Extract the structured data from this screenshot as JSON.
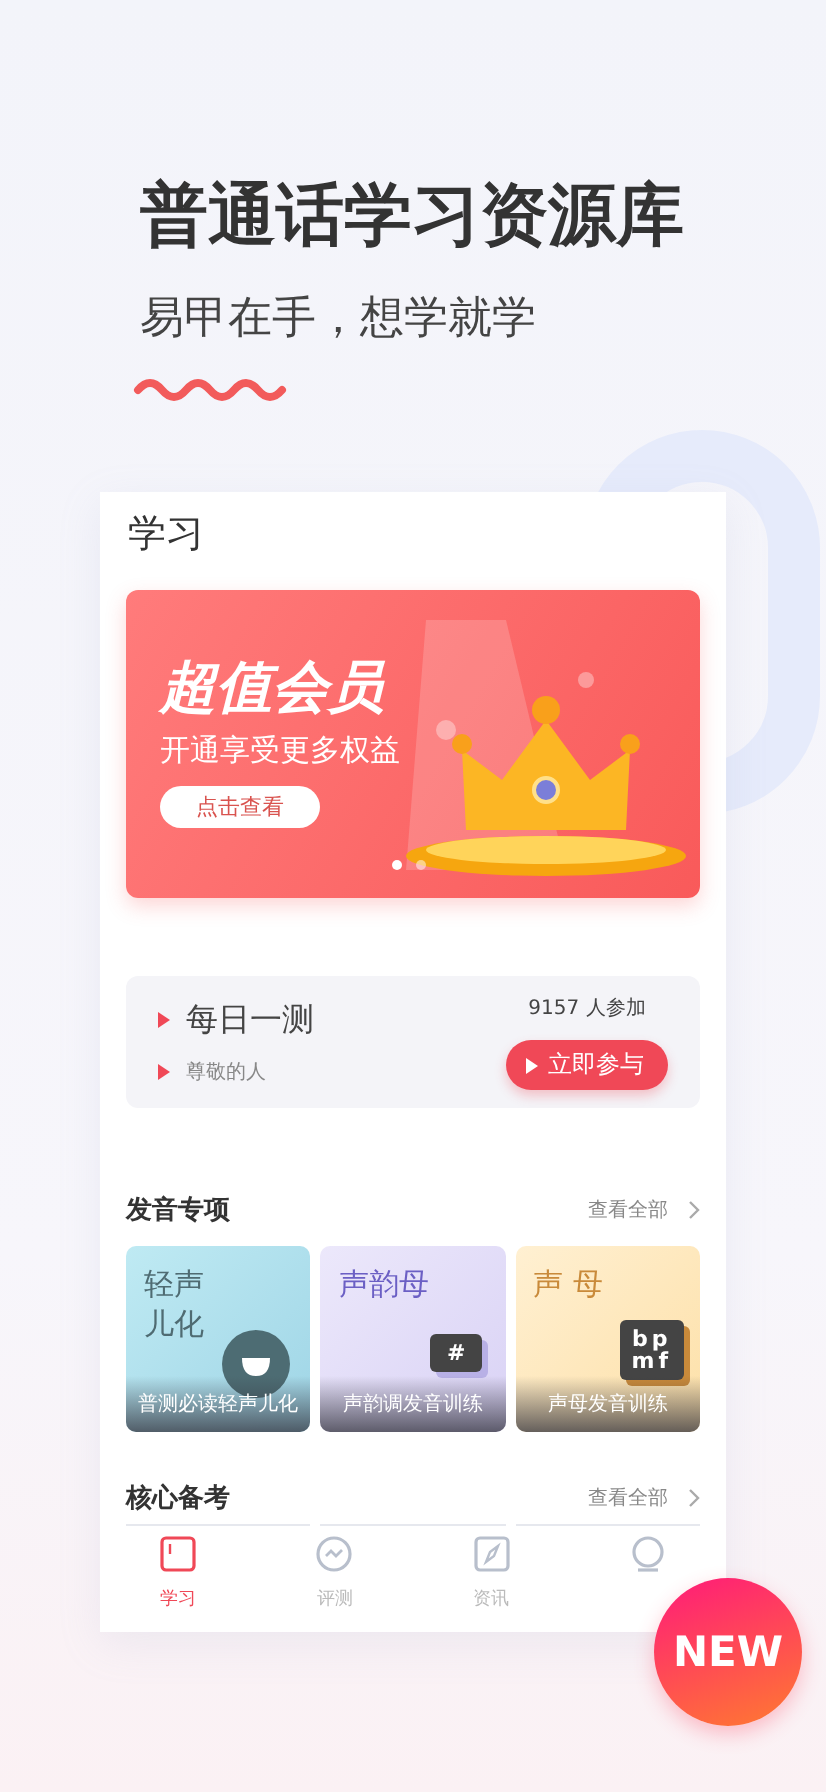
{
  "headline": "普通话学习资源库",
  "subtitle": "易甲在手，想学就学",
  "page": {
    "title": "学习"
  },
  "banner": {
    "title": "超值会员",
    "subtitle": "开通享受更多权益",
    "button": "点击查看",
    "dots": [
      {
        "selected": true
      },
      {
        "selected": false
      }
    ]
  },
  "daily": {
    "title": "每日一测",
    "subtitle": "尊敬的人",
    "count": "9157 人参加",
    "button": "立即参与"
  },
  "sections": [
    {
      "title": "发音专项",
      "more": "查看全部",
      "cards": [
        {
          "kind": "face",
          "title": [
            "轻声",
            "儿化"
          ],
          "caption": "普测必读轻声儿化"
        },
        {
          "kind": "bubble",
          "title": [
            "声韵母"
          ],
          "badge": [
            "#"
          ],
          "caption": "声韵调发音训练"
        },
        {
          "kind": "board",
          "title": [
            "声 母"
          ],
          "badge": [
            "bp",
            "mf"
          ],
          "caption": "声母发音训练"
        }
      ]
    },
    {
      "title": "核心备考",
      "more": "查看全部"
    }
  ],
  "tabs": [
    {
      "label": "学习",
      "selected": true
    },
    {
      "label": "评测",
      "selected": false
    },
    {
      "label": "资讯",
      "selected": false
    },
    {
      "selected": false
    }
  ],
  "badge": {
    "label": "NEW"
  }
}
